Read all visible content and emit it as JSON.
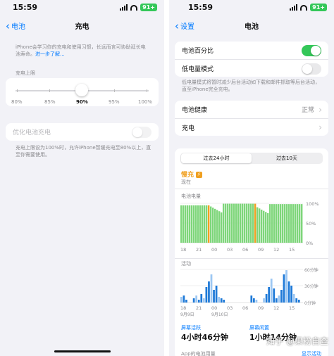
{
  "left": {
    "status": {
      "time": "15:59",
      "battery": "91+"
    },
    "nav": {
      "back": "电池",
      "title": "充电"
    },
    "intro": "iPhone会学习你的充电和使用习惯，长远而言可协助延长电池寿命。",
    "intro_link": "进一步了解...",
    "limit_header": "充电上限",
    "limit_stops": [
      "80%",
      "85%",
      "90%",
      "95%",
      "100%"
    ],
    "limit_selected": "90%",
    "optimize": {
      "label": "优化电池充电",
      "enabled": false
    },
    "optimize_note": "充电上限设为100%时，允许iPhone暂缓充电至80%以上，直至你需要使用。"
  },
  "right": {
    "status": {
      "time": "15:59",
      "battery": "91+"
    },
    "nav": {
      "back": "设置",
      "title": "电池"
    },
    "rows1": [
      {
        "label": "电池百分比",
        "on": true
      },
      {
        "label": "低电量模式",
        "on": false
      }
    ],
    "lowpower_note": "低电量模式将暂时减少后台活动如下载和邮件抓取等后台活动，直至iPhone完全充电。",
    "rows2": [
      {
        "label": "电池健康",
        "value": "正常"
      },
      {
        "label": "充电",
        "value": ""
      }
    ],
    "tabs": [
      "过去24小时",
      "过去10天"
    ],
    "slow_charge": {
      "label": "慢充",
      "sub": "现在"
    },
    "battery_chart": {
      "title": "电池电量",
      "y_ticks": [
        "100%",
        "50%",
        "0%"
      ],
      "x_ticks": [
        "18",
        "21",
        "00",
        "03",
        "06",
        "09",
        "12",
        "15"
      ]
    },
    "activity_chart": {
      "title": "活动",
      "y_ticks": [
        "60分钟",
        "30分钟",
        "0分钟"
      ],
      "x_ticks": [
        "18",
        "21",
        "00",
        "03",
        "06",
        "09",
        "12",
        "15"
      ],
      "date_labels": [
        "9月9日",
        "9月10日"
      ]
    },
    "screen_on": {
      "label": "屏幕活跃",
      "value": "4小时46分钟"
    },
    "screen_off": {
      "label": "屏幕闲置",
      "value": "1小时14分钟"
    },
    "footer_left": "App的电池用量",
    "footer_right": "显示活动"
  },
  "watermark": "知乎 @果粉自查",
  "colors": {
    "accent": "#007aff",
    "green": "#34c759",
    "orange": "#f0a020",
    "bar_blue": "#1f7ad8",
    "bar_light": "#9cc7f3",
    "level_green": "#7ed67a"
  }
}
